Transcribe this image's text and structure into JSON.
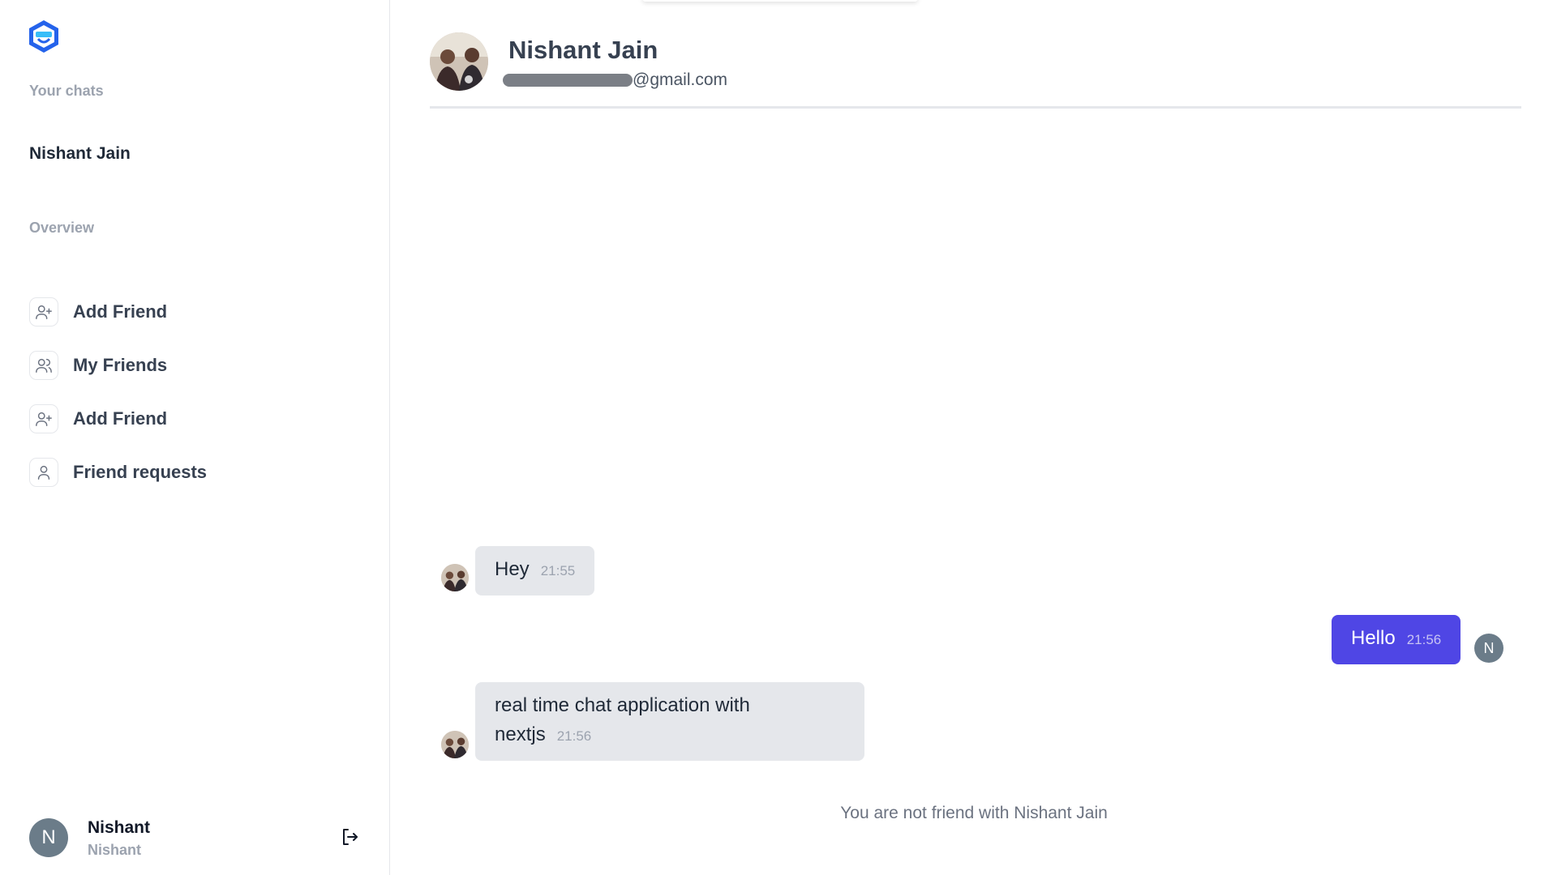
{
  "sidebar": {
    "logo_icon": "shield-chat-logo",
    "your_chats_label": "Your chats",
    "chats": [
      {
        "name": "Nishant Jain"
      }
    ],
    "overview_label": "Overview",
    "nav": [
      {
        "label": "Add Friend",
        "icon": "user-plus-icon"
      },
      {
        "label": "My Friends",
        "icon": "users-icon"
      },
      {
        "label": "Add Friend",
        "icon": "user-plus-icon"
      },
      {
        "label": "Friend requests",
        "icon": "user-icon"
      }
    ],
    "profile": {
      "initial": "N",
      "name": "Nishant",
      "subtitle": "Nishant",
      "signout_icon": "sign-out-icon"
    }
  },
  "chat": {
    "partner_name": "Nishant Jain",
    "email_domain": "@gmail.com",
    "messages": [
      {
        "from": "partner",
        "text": "Hey",
        "time": "21:55"
      },
      {
        "from": "me",
        "text": "Hello",
        "time": "21:56",
        "avatar_initial": "N"
      },
      {
        "from": "partner",
        "text": "real time chat application with nextjs",
        "time": "21:56"
      }
    ],
    "notice": "You are not friend with Nishant Jain"
  },
  "colors": {
    "accent": "#4f46e5",
    "logo": "#2563eb",
    "bubble_partner": "#e5e7eb",
    "avatar_bg": "#6b7c89"
  }
}
